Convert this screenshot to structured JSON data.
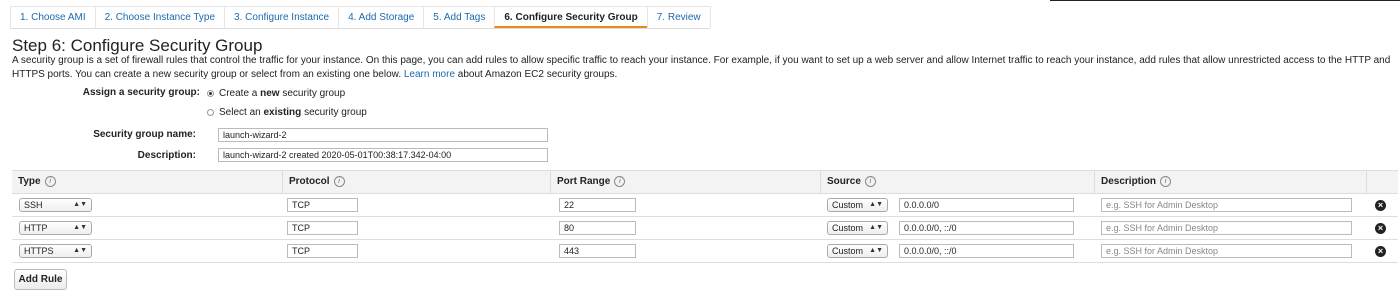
{
  "tabs": [
    {
      "label": "1. Choose AMI"
    },
    {
      "label": "2. Choose Instance Type"
    },
    {
      "label": "3. Configure Instance"
    },
    {
      "label": "4. Add Storage"
    },
    {
      "label": "5. Add Tags"
    },
    {
      "label": "6. Configure Security Group",
      "active": true
    },
    {
      "label": "7. Review"
    }
  ],
  "page": {
    "title": "Step 6: Configure Security Group",
    "intro": "A security group is a set of firewall rules that control the traffic for your instance. On this page, you can add rules to allow specific traffic to reach your instance. For example, if you want to set up a web server and allow Internet traffic to reach your instance, add rules that allow unrestricted access to the HTTP and HTTPS ports. You can create a new security group or select from an existing one below.",
    "learn_more": "Learn more",
    "intro_tail": "about Amazon EC2 security groups."
  },
  "assign": {
    "label": "Assign a security group:",
    "option_new_pre": "Create a",
    "option_new_bold": "new",
    "option_new_post": "security group",
    "option_existing_pre": "Select an",
    "option_existing_bold": "existing",
    "option_existing_post": "security group",
    "selected": "new"
  },
  "group": {
    "name_label": "Security group name:",
    "name_value": "launch-wizard-2",
    "desc_label": "Description:",
    "desc_value": "launch-wizard-2 created 2020-05-01T00:38:17.342-04:00"
  },
  "table": {
    "headers": {
      "type": "Type",
      "protocol": "Protocol",
      "port": "Port Range",
      "source": "Source",
      "description": "Description"
    },
    "info_glyph": "i",
    "rows": [
      {
        "type": "SSH",
        "protocol": "TCP",
        "port": "22",
        "source_mode": "Custom",
        "source": "0.0.0.0/0",
        "desc_placeholder": "e.g. SSH for Admin Desktop"
      },
      {
        "type": "HTTP",
        "protocol": "TCP",
        "port": "80",
        "source_mode": "Custom",
        "source": "0.0.0.0/0, ::/0",
        "desc_placeholder": "e.g. SSH for Admin Desktop"
      },
      {
        "type": "HTTPS",
        "protocol": "TCP",
        "port": "443",
        "source_mode": "Custom",
        "source": "0.0.0.0/0, ::/0",
        "desc_placeholder": "e.g. SSH for Admin Desktop"
      }
    ]
  },
  "add_rule_label": "Add Rule",
  "icons": {
    "remove": "close-circle-icon",
    "info": "info-icon",
    "select_arrow": "chevron-updown-icon"
  },
  "colors": {
    "accent": "#e98b17",
    "link": "#1c6aad"
  }
}
